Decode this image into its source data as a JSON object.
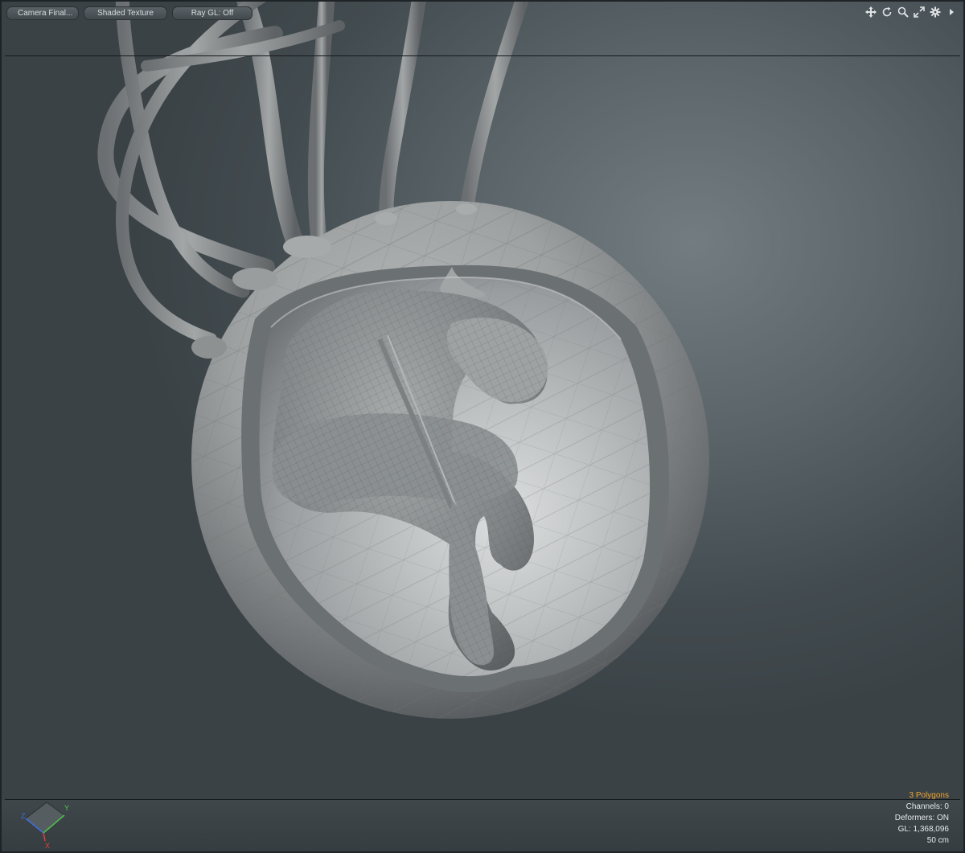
{
  "toolbar": {
    "camera_label": "Camera Final...",
    "shading_label": "Shaded Texture",
    "ray_gl_label": "Ray GL: Off"
  },
  "nav_icons": [
    "move-icon",
    "rotate-icon",
    "zoom-icon",
    "fit-icon",
    "gear-icon",
    "arrow-right-icon"
  ],
  "axis": {
    "x": "X",
    "y": "Y",
    "z": "Z"
  },
  "stats": {
    "polygons": "3 Polygons",
    "channels": "Channels: 0",
    "deformers": "Deformers: ON",
    "gl": "GL: 1,368,096",
    "scale": "50 cm"
  },
  "colors": {
    "accent_orange": "#f0a12c",
    "axis_x": "#e0403a",
    "axis_y": "#4fc14a",
    "axis_z": "#3e6fe0"
  }
}
